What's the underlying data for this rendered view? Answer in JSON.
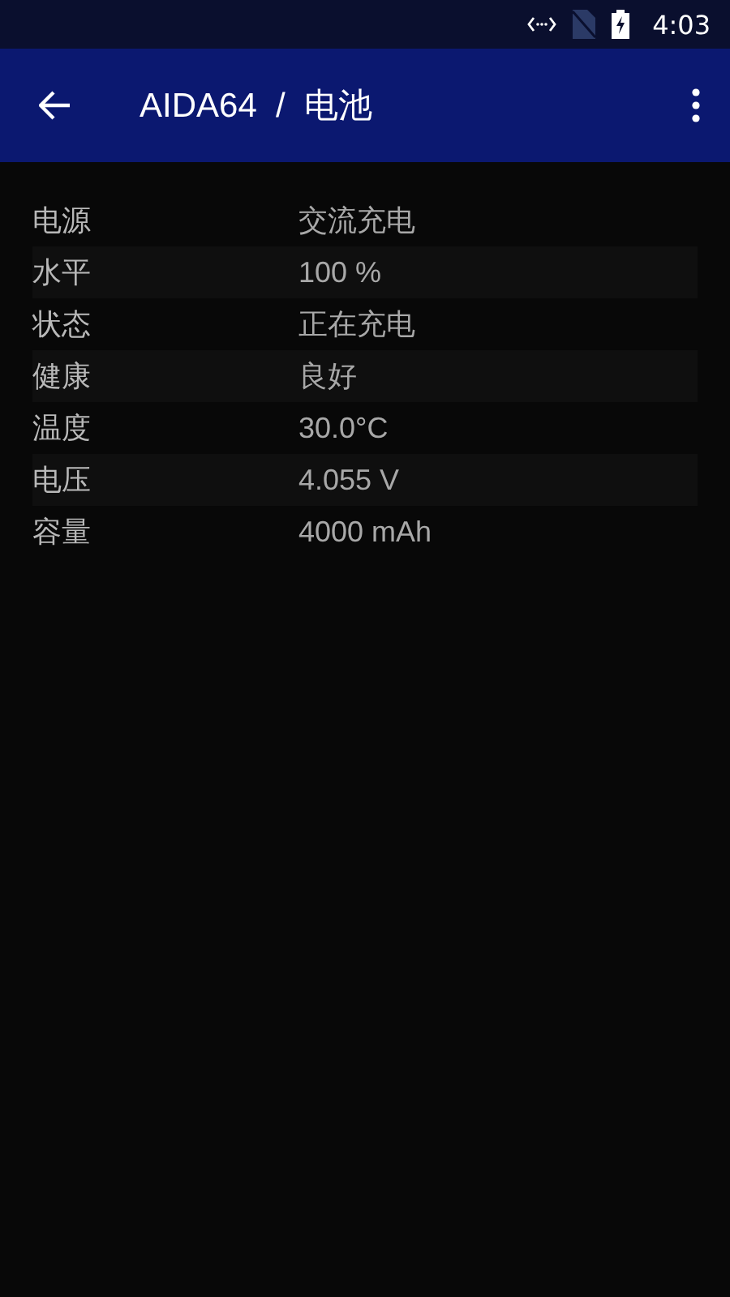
{
  "status_bar": {
    "time": "4:03"
  },
  "app_bar": {
    "title": "AIDA64  /  电池"
  },
  "rows": [
    {
      "label": "电源",
      "value": "交流充电"
    },
    {
      "label": "水平",
      "value": "100 %"
    },
    {
      "label": "状态",
      "value": "正在充电"
    },
    {
      "label": "健康",
      "value": "良好"
    },
    {
      "label": "温度",
      "value": "30.0°C"
    },
    {
      "label": "电压",
      "value": "4.055 V"
    },
    {
      "label": "容量",
      "value": "4000 mAh"
    }
  ]
}
